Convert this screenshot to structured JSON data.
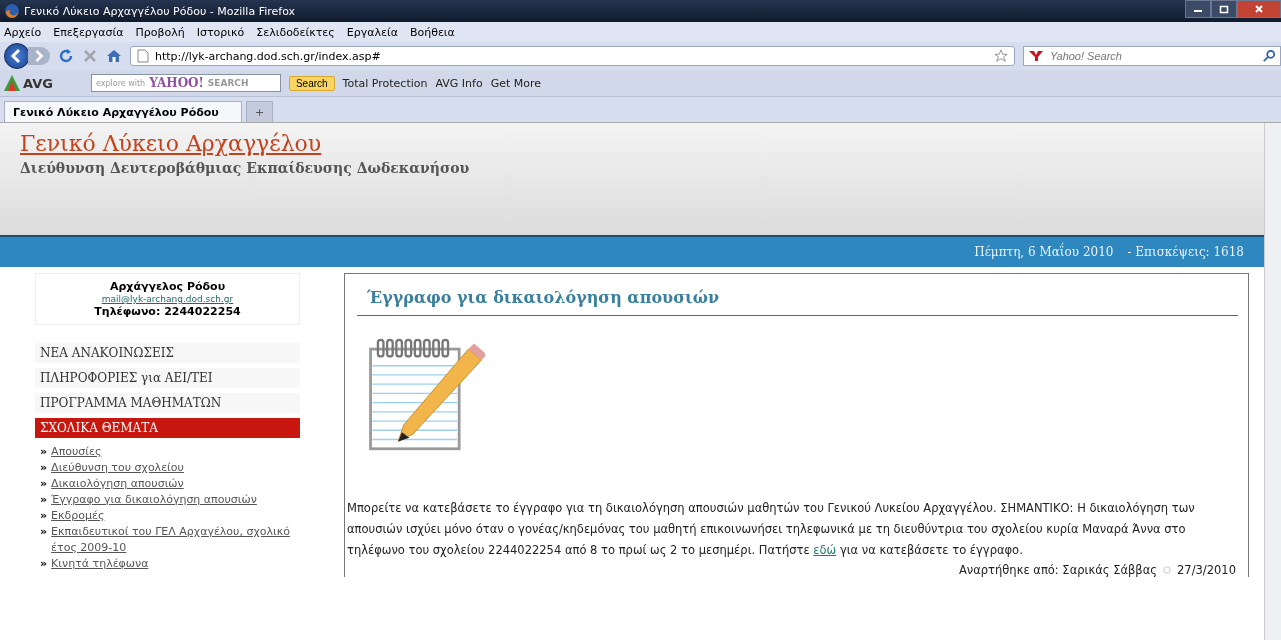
{
  "window": {
    "title": "Γενικό Λύκειο Αρχαγγέλου Ρόδου - Mozilla Firefox"
  },
  "menu": [
    "Αρχείο",
    "Επεξεργασία",
    "Προβολή",
    "Ιστορικό",
    "Σελιδοδείκτες",
    "Εργαλεία",
    "Βοήθεια"
  ],
  "navbar": {
    "url": "http://lyk-archang.dod.sch.gr/index.asp#",
    "search_placeholder": "Yahoo! Search"
  },
  "toolbar": {
    "brand": "AVG",
    "search_hint": "explore with",
    "search_logo": "YAHOO!",
    "search_word": "SEARCH",
    "search_button": "Search",
    "items": [
      "Total Protection",
      "AVG Info",
      "Get More"
    ]
  },
  "tabs": [
    {
      "label": "Γενικό Λύκειο Αρχαγγέλου Ρόδου",
      "selected": true
    },
    {
      "label": "+",
      "selected": false
    }
  ],
  "header": {
    "title": "Γενικό Λύκειο Αρχαγγέλου",
    "subtitle": "Διεύθυνση Δευτεροβάθμιας Εκπαίδευσης Δωδεκανήσου"
  },
  "info_bar": {
    "date": "Πέμπτη, 6 Μαΐου 2010",
    "visits": "- Επισκέψεις: 1618"
  },
  "contact": {
    "name": "Αρχάγγελος Ρόδου",
    "email": "mail@lyk-archang.dod.sch.gr",
    "phone": "Τηλέφωνο: 2244022254"
  },
  "sidebar_menu": [
    {
      "label": "ΝΕΑ ΑΝΑΚΟΙΝΩΣΕΙΣ",
      "selected": false
    },
    {
      "label": "ΠΛΗΡΟΦΟΡΙΕΣ για ΑΕΙ/ΤΕΙ",
      "selected": false
    },
    {
      "label": "ΠΡΟΓΡΑΜΜΑ ΜΑΘΗΜΑΤΩΝ",
      "selected": false
    },
    {
      "label": "ΣΧΟΛΙΚΑ ΘΕΜΑΤΑ",
      "selected": true
    }
  ],
  "submenu": {
    "bullet": "»",
    "links": [
      "Απουσίες",
      "Διεύθυνση του σχολείου",
      "Δικαιολόγηση απουσιών",
      "Έγγραφο για δικαιολόγηση απουσιών",
      "Εκδρομές",
      "Εκπαιδευτικοί του ΓΕΛ Αρχαγέλου, σχολικό έτος 2009-10",
      "Κινητά τηλέφωνα"
    ]
  },
  "article": {
    "heading": "Έγγραφο για δικαιολόγηση απουσιών",
    "text_before": "Μπορείτε να κατεβάσετε το έγγραφο για τη δικαιολόγηση απουσιών μαθητών του Γενικού Λυκείου Αρχαγγέλου. ΣΗΜΑΝΤΙΚΟ: Η δικαιολόγηση των απουσιών ισχύει μόνο όταν ο γονέας/κηδεμόνας του μαθητή επικοινωνήσει τηλεφωνικά με τη διευθύντρια του σχολείου κυρία Μαναρά Άννα στο τηλέφωνο του σχολείου 2244022254 από 8 το πρωί ως 2 το μεσημέρι. Πατήστε",
    "link": "εδώ",
    "text_after": "για να κατεβάσετε το έγγραφο.",
    "posted_by": "Αναρτήθηκε από: Σαρικάς Σάββας",
    "posted_date": "27/3/2010"
  }
}
